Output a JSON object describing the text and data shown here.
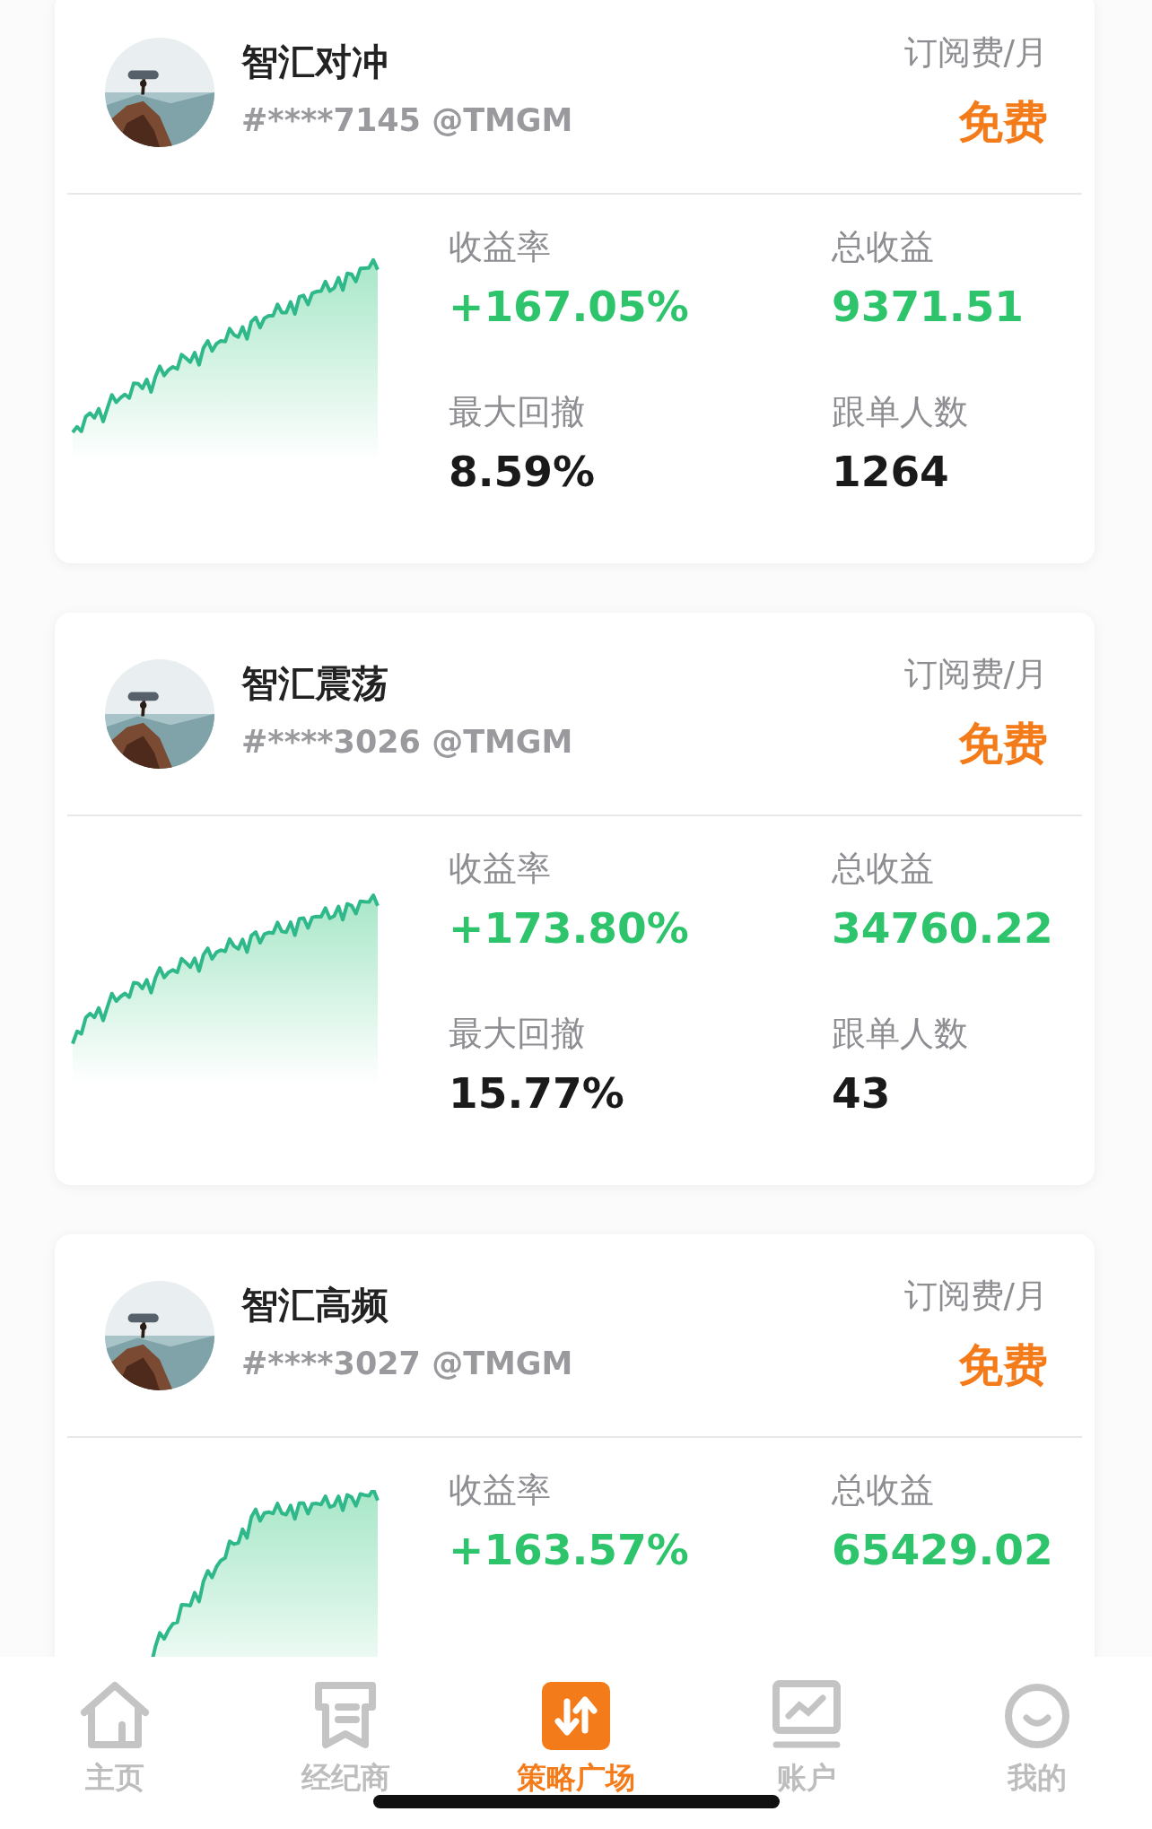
{
  "strategies": [
    {
      "name": "智汇对冲",
      "account": "#****7145 @TMGM",
      "fee_label": "订阅费/月",
      "fee": "免费",
      "stats": [
        {
          "label": "收益率",
          "value": "+167.05%",
          "kind": "profit"
        },
        {
          "label": "总收益",
          "value": "9371.51",
          "kind": "profit"
        },
        {
          "label": "最大回撤",
          "value": "8.59%",
          "kind": "neutral"
        },
        {
          "label": "跟单人数",
          "value": "1264",
          "kind": "neutral"
        }
      ]
    },
    {
      "name": "智汇震荡",
      "account": "#****3026 @TMGM",
      "fee_label": "订阅费/月",
      "fee": "免费",
      "stats": [
        {
          "label": "收益率",
          "value": "+173.80%",
          "kind": "profit"
        },
        {
          "label": "总收益",
          "value": "34760.22",
          "kind": "profit"
        },
        {
          "label": "最大回撤",
          "value": "15.77%",
          "kind": "neutral"
        },
        {
          "label": "跟单人数",
          "value": "43",
          "kind": "neutral"
        }
      ]
    },
    {
      "name": "智汇高频",
      "account": "#****3027 @TMGM",
      "fee_label": "订阅费/月",
      "fee": "免费",
      "stats": [
        {
          "label": "收益率",
          "value": "+163.57%",
          "kind": "profit"
        },
        {
          "label": "总收益",
          "value": "65429.02",
          "kind": "profit"
        }
      ]
    }
  ],
  "nav": [
    {
      "label": "主页",
      "selected": false
    },
    {
      "label": "经纪商",
      "selected": false
    },
    {
      "label": "策略广场",
      "selected": true
    },
    {
      "label": "账户",
      "selected": false
    },
    {
      "label": "我的",
      "selected": false
    }
  ]
}
